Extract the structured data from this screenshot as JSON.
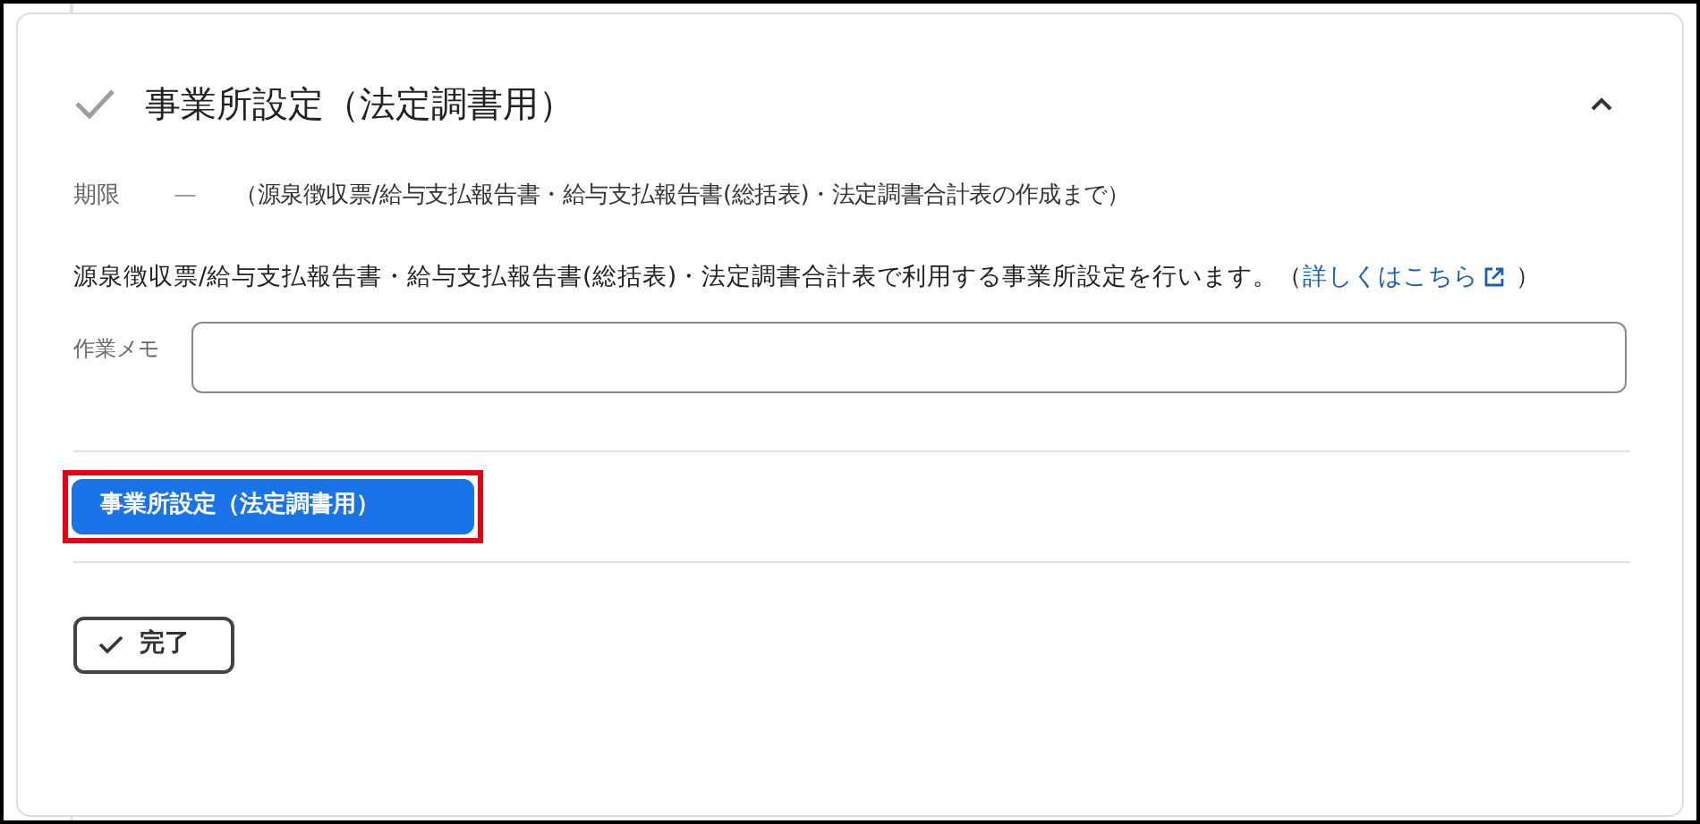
{
  "task": {
    "title": "事業所設定（法定調書用）",
    "expanded": true,
    "completed": false,
    "deadline_label": "期限",
    "deadline_dash": "—",
    "deadline_note": "（源泉徴収票/給与支払報告書・給与支払報告書(総括表)・法定調書合計表の作成まで）",
    "description": "源泉徴収票/給与支払報告書・給与支払報告書(総括表)・法定調書合計表で利用する事業所設定を行います。（",
    "link": "詳しくはこちら",
    "description_end": "）",
    "memo": {
      "label": "作業メモ"
    },
    "action_button": {
      "label": "事業所設定（法定調書用）",
      "highlighted": true
    },
    "done_button": {
      "label": "完了"
    }
  }
}
